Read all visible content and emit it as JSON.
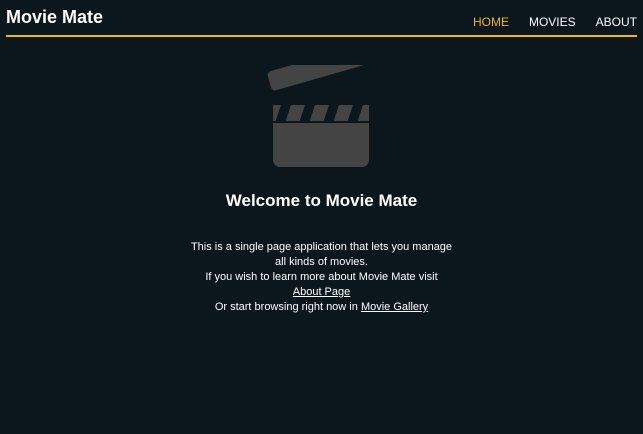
{
  "header": {
    "brand": "Movie Mate",
    "nav": [
      {
        "label": "HOME",
        "active": true
      },
      {
        "label": "MOVIES",
        "active": false
      },
      {
        "label": "ABOUT",
        "active": false
      }
    ]
  },
  "main": {
    "icon": "clapperboard-icon",
    "title": "Welcome to Movie Mate",
    "description": "This is a single page application that lets you manage all kinds of movies.",
    "learn_more_text": "If you wish to learn more about Movie Mate visit",
    "about_link": "About Page",
    "browse_text": "Or start browsing right now in",
    "gallery_link": "Movie Gallery"
  },
  "colors": {
    "background": "#0b161d",
    "accent": "#f0b429",
    "text": "#ffffff",
    "icon": "#444444"
  }
}
